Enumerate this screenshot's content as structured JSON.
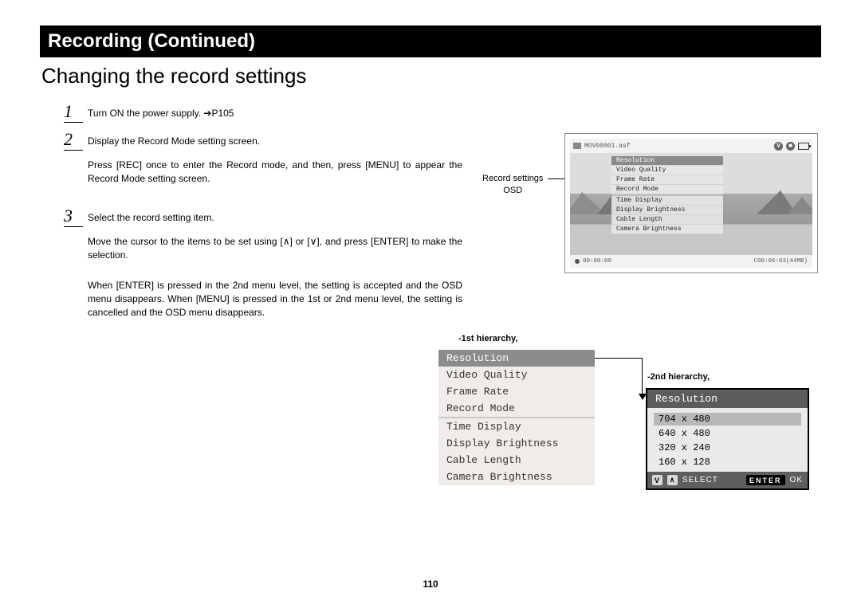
{
  "header": "Recording (Continued)",
  "section_title": "Changing the record settings",
  "steps": {
    "s1": {
      "num": "1",
      "text": "Turn ON the power supply. ➔P105"
    },
    "s2": {
      "num": "2",
      "title": "Display the Record Mode setting screen.",
      "body": "Press [REC] once to enter the Record mode, and then, press [MENU] to appear the Record Mode setting screen."
    },
    "s3": {
      "num": "3",
      "title": "Select the record setting item.",
      "body": "Move the cursor to the items to be set using [∧] or [∨], and press [ENTER] to make the selection.",
      "note": "When [ENTER] is pressed in the 2nd menu level, the setting is accepted and the OSD menu disappears. When [MENU] is pressed in the 1st or 2nd menu level, the setting is cancelled and the OSD menu disappears."
    }
  },
  "labels": {
    "osd": "Record settings\nOSD",
    "h1": "-1st hierarchy,",
    "h2": "-2nd hierarchy,"
  },
  "screen": {
    "filename": "MOV00001.asf",
    "time_left": "00:00:00",
    "time_right": "C00:06:03(44MB)",
    "menu_items_a": [
      "Resolution",
      "Video Quality",
      "Frame Rate",
      "Record Mode"
    ],
    "menu_items_b": [
      "Time Display",
      "Display Brightness",
      "Cable Length",
      "Camera Brightness"
    ]
  },
  "menu1": {
    "group_a": [
      "Resolution",
      "Video Quality",
      "Frame Rate",
      "Record Mode"
    ],
    "group_b": [
      "Time Display",
      "Display Brightness",
      "Cable Length",
      "Camera Brightness"
    ]
  },
  "menu2": {
    "title": "Resolution",
    "options": [
      "704 x 480",
      "640 x 480",
      "320 x 240",
      "160 x 128"
    ],
    "footer": {
      "select": "SELECT",
      "enter": "ENTER",
      "ok": "OK"
    }
  },
  "page_number": "110"
}
